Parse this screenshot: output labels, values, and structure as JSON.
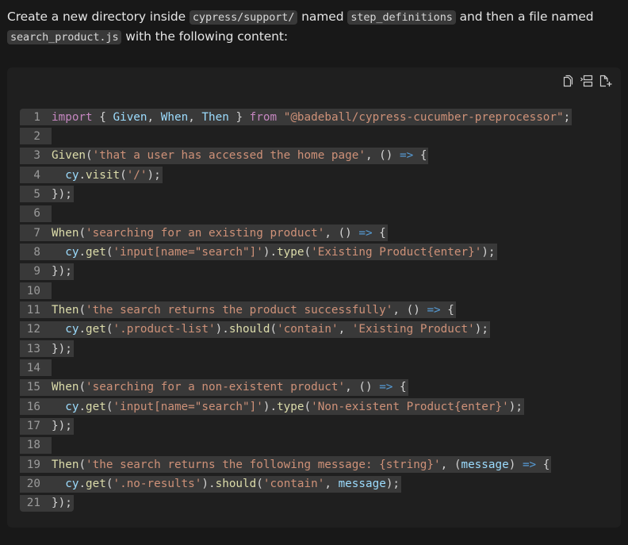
{
  "intro": {
    "parts": [
      {
        "type": "text",
        "value": "Create a new directory inside "
      },
      {
        "type": "code",
        "value": "cypress/support/"
      },
      {
        "type": "text",
        "value": " named "
      },
      {
        "type": "code",
        "value": "step_definitions"
      },
      {
        "type": "text",
        "value": " and then a file named "
      },
      {
        "type": "code",
        "value": "search_product.js"
      },
      {
        "type": "text",
        "value": " with the following content:"
      }
    ]
  },
  "code_block": {
    "language": "javascript",
    "toolbar": [
      {
        "name": "copy-icon",
        "label": "Copy"
      },
      {
        "name": "insert-at-cursor-icon",
        "label": "Insert at cursor"
      },
      {
        "name": "new-file-icon",
        "label": "Insert into new file"
      }
    ],
    "colors": {
      "keyword": "#c586c0",
      "variable": "#9cdcfe",
      "string": "#ce9178",
      "function": "#dcdcaa",
      "punctuation": "#d4d4d4",
      "arrow": "#569cd6"
    },
    "lines": [
      {
        "n": "1",
        "tokens": [
          [
            "kw",
            "import"
          ],
          [
            "pun",
            " { "
          ],
          [
            "var",
            "Given"
          ],
          [
            "pun",
            ", "
          ],
          [
            "var",
            "When"
          ],
          [
            "pun",
            ", "
          ],
          [
            "var",
            "Then"
          ],
          [
            "pun",
            " } "
          ],
          [
            "kw",
            "from"
          ],
          [
            "pun",
            " "
          ],
          [
            "str",
            "\"@badeball/cypress-cucumber-preprocessor\""
          ],
          [
            "pun",
            ";"
          ]
        ]
      },
      {
        "n": "2",
        "tokens": []
      },
      {
        "n": "3",
        "tokens": [
          [
            "fn",
            "Given"
          ],
          [
            "pun",
            "("
          ],
          [
            "str",
            "'that a user has accessed the home page'"
          ],
          [
            "pun",
            ", () "
          ],
          [
            "arrow",
            "=>"
          ],
          [
            "pun",
            " {"
          ]
        ]
      },
      {
        "n": "4",
        "tokens": [
          [
            "pun",
            "  "
          ],
          [
            "var",
            "cy"
          ],
          [
            "pun",
            "."
          ],
          [
            "fn",
            "visit"
          ],
          [
            "pun",
            "("
          ],
          [
            "str",
            "'/'"
          ],
          [
            "pun",
            ");"
          ]
        ]
      },
      {
        "n": "5",
        "tokens": [
          [
            "pun",
            "});"
          ]
        ]
      },
      {
        "n": "6",
        "tokens": []
      },
      {
        "n": "7",
        "tokens": [
          [
            "fn",
            "When"
          ],
          [
            "pun",
            "("
          ],
          [
            "str",
            "'searching for an existing product'"
          ],
          [
            "pun",
            ", () "
          ],
          [
            "arrow",
            "=>"
          ],
          [
            "pun",
            " {"
          ]
        ]
      },
      {
        "n": "8",
        "tokens": [
          [
            "pun",
            "  "
          ],
          [
            "var",
            "cy"
          ],
          [
            "pun",
            "."
          ],
          [
            "fn",
            "get"
          ],
          [
            "pun",
            "("
          ],
          [
            "str",
            "'input[name=\"search\"]'"
          ],
          [
            "pun",
            ")."
          ],
          [
            "fn",
            "type"
          ],
          [
            "pun",
            "("
          ],
          [
            "str",
            "'Existing Product{enter}'"
          ],
          [
            "pun",
            ");"
          ]
        ]
      },
      {
        "n": "9",
        "tokens": [
          [
            "pun",
            "});"
          ]
        ]
      },
      {
        "n": "10",
        "tokens": []
      },
      {
        "n": "11",
        "tokens": [
          [
            "fn",
            "Then"
          ],
          [
            "pun",
            "("
          ],
          [
            "str",
            "'the search returns the product successfully'"
          ],
          [
            "pun",
            ", () "
          ],
          [
            "arrow",
            "=>"
          ],
          [
            "pun",
            " {"
          ]
        ]
      },
      {
        "n": "12",
        "tokens": [
          [
            "pun",
            "  "
          ],
          [
            "var",
            "cy"
          ],
          [
            "pun",
            "."
          ],
          [
            "fn",
            "get"
          ],
          [
            "pun",
            "("
          ],
          [
            "str",
            "'.product-list'"
          ],
          [
            "pun",
            ")."
          ],
          [
            "fn",
            "should"
          ],
          [
            "pun",
            "("
          ],
          [
            "str",
            "'contain'"
          ],
          [
            "pun",
            ", "
          ],
          [
            "str",
            "'Existing Product'"
          ],
          [
            "pun",
            ");"
          ]
        ]
      },
      {
        "n": "13",
        "tokens": [
          [
            "pun",
            "});"
          ]
        ]
      },
      {
        "n": "14",
        "tokens": []
      },
      {
        "n": "15",
        "tokens": [
          [
            "fn",
            "When"
          ],
          [
            "pun",
            "("
          ],
          [
            "str",
            "'searching for a non-existent product'"
          ],
          [
            "pun",
            ", () "
          ],
          [
            "arrow",
            "=>"
          ],
          [
            "pun",
            " {"
          ]
        ]
      },
      {
        "n": "16",
        "tokens": [
          [
            "pun",
            "  "
          ],
          [
            "var",
            "cy"
          ],
          [
            "pun",
            "."
          ],
          [
            "fn",
            "get"
          ],
          [
            "pun",
            "("
          ],
          [
            "str",
            "'input[name=\"search\"]'"
          ],
          [
            "pun",
            ")."
          ],
          [
            "fn",
            "type"
          ],
          [
            "pun",
            "("
          ],
          [
            "str",
            "'Non-existent Product{enter}'"
          ],
          [
            "pun",
            ");"
          ]
        ]
      },
      {
        "n": "17",
        "tokens": [
          [
            "pun",
            "});"
          ]
        ]
      },
      {
        "n": "18",
        "tokens": []
      },
      {
        "n": "19",
        "tokens": [
          [
            "fn",
            "Then"
          ],
          [
            "pun",
            "("
          ],
          [
            "str",
            "'the search returns the following message: {string}'"
          ],
          [
            "pun",
            ", ("
          ],
          [
            "prm",
            "message"
          ],
          [
            "pun",
            ") "
          ],
          [
            "arrow",
            "=>"
          ],
          [
            "pun",
            " {"
          ]
        ]
      },
      {
        "n": "20",
        "tokens": [
          [
            "pun",
            "  "
          ],
          [
            "var",
            "cy"
          ],
          [
            "pun",
            "."
          ],
          [
            "fn",
            "get"
          ],
          [
            "pun",
            "("
          ],
          [
            "str",
            "'.no-results'"
          ],
          [
            "pun",
            ")."
          ],
          [
            "fn",
            "should"
          ],
          [
            "pun",
            "("
          ],
          [
            "str",
            "'contain'"
          ],
          [
            "pun",
            ", "
          ],
          [
            "prm",
            "message"
          ],
          [
            "pun",
            ");"
          ]
        ]
      },
      {
        "n": "21",
        "tokens": [
          [
            "pun",
            "});"
          ]
        ]
      }
    ]
  }
}
